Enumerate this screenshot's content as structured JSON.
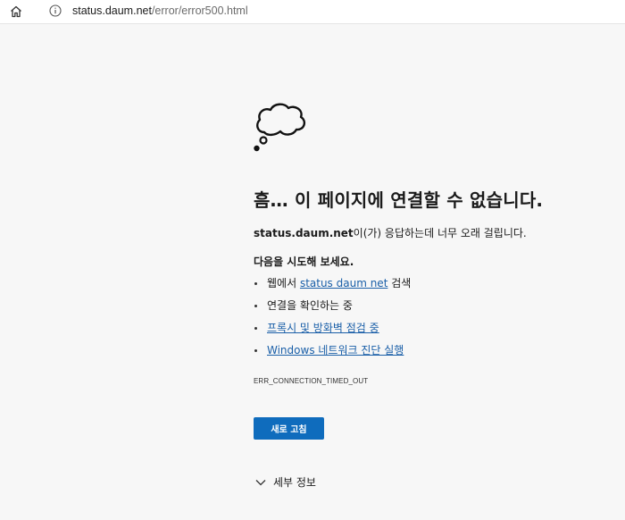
{
  "address_bar": {
    "domain": "status.daum.net",
    "path": "/error/error500.html"
  },
  "error": {
    "title": "흠… 이 페이지에 연결할 수 없습니다.",
    "host": "status.daum.net",
    "desc_suffix": "이(가) 응답하는데 너무 오래 걸립니다.",
    "try_heading": "다음을 시도해 보세요.",
    "suggestions": {
      "s1_prefix": "웹에서 ",
      "s1_link": "status daum net",
      "s1_suffix": " 검색",
      "s2": "연결을 확인하는 중",
      "s3_link": "프록시 및 방화벽 점검 중",
      "s4_link": "Windows 네트워크 진단 실행"
    },
    "code": "ERR_CONNECTION_TIMED_OUT",
    "reload_label": "새로 고침",
    "details_label": "세부 정보"
  },
  "icons": {
    "home": "home-icon",
    "info": "info-icon",
    "cloud": "thought-cloud-icon",
    "chevron": "chevron-down-icon"
  },
  "colors": {
    "accent": "#0f6cbd",
    "link": "#1a5fa8",
    "background": "#f7f7f7"
  }
}
